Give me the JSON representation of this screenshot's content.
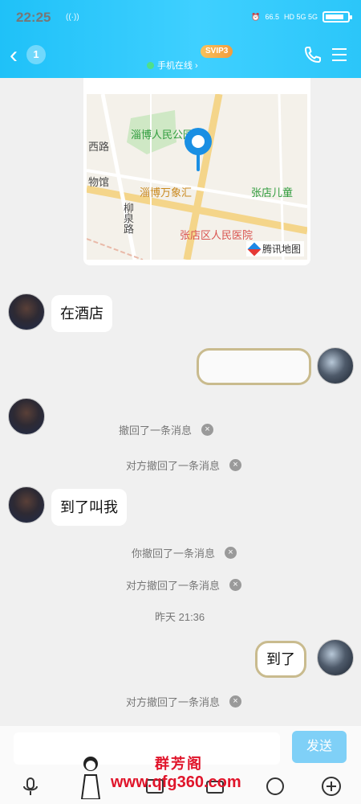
{
  "status_bar": {
    "time": "22:25",
    "speed": "66.5\nKB/s",
    "network": "HD 5G 5G"
  },
  "header": {
    "unread_count": "1",
    "vip_badge": "SVIP3",
    "online_status": "手机在线 ›"
  },
  "map": {
    "labels": [
      "淄博人民公园",
      "西路",
      "物馆",
      "淄博万象汇",
      "张店儿童",
      "柳泉路",
      "张店区人民医院"
    ],
    "attribution": "腾讯地图"
  },
  "messages": {
    "m1": "在酒店",
    "sys1": "撤回了一条消息",
    "sys2": "对方撤回了一条消息",
    "m2": "到了叫我",
    "sys3": "你撤回了一条消息",
    "sys4": "对方撤回了一条消息",
    "timestamp": "昨天 21:36",
    "m3": "到了",
    "sys5": "对方撤回了一条消息"
  },
  "input": {
    "send_label": "发送"
  },
  "watermark": {
    "top": "群芳阁",
    "url": "www.qfg360.com"
  }
}
